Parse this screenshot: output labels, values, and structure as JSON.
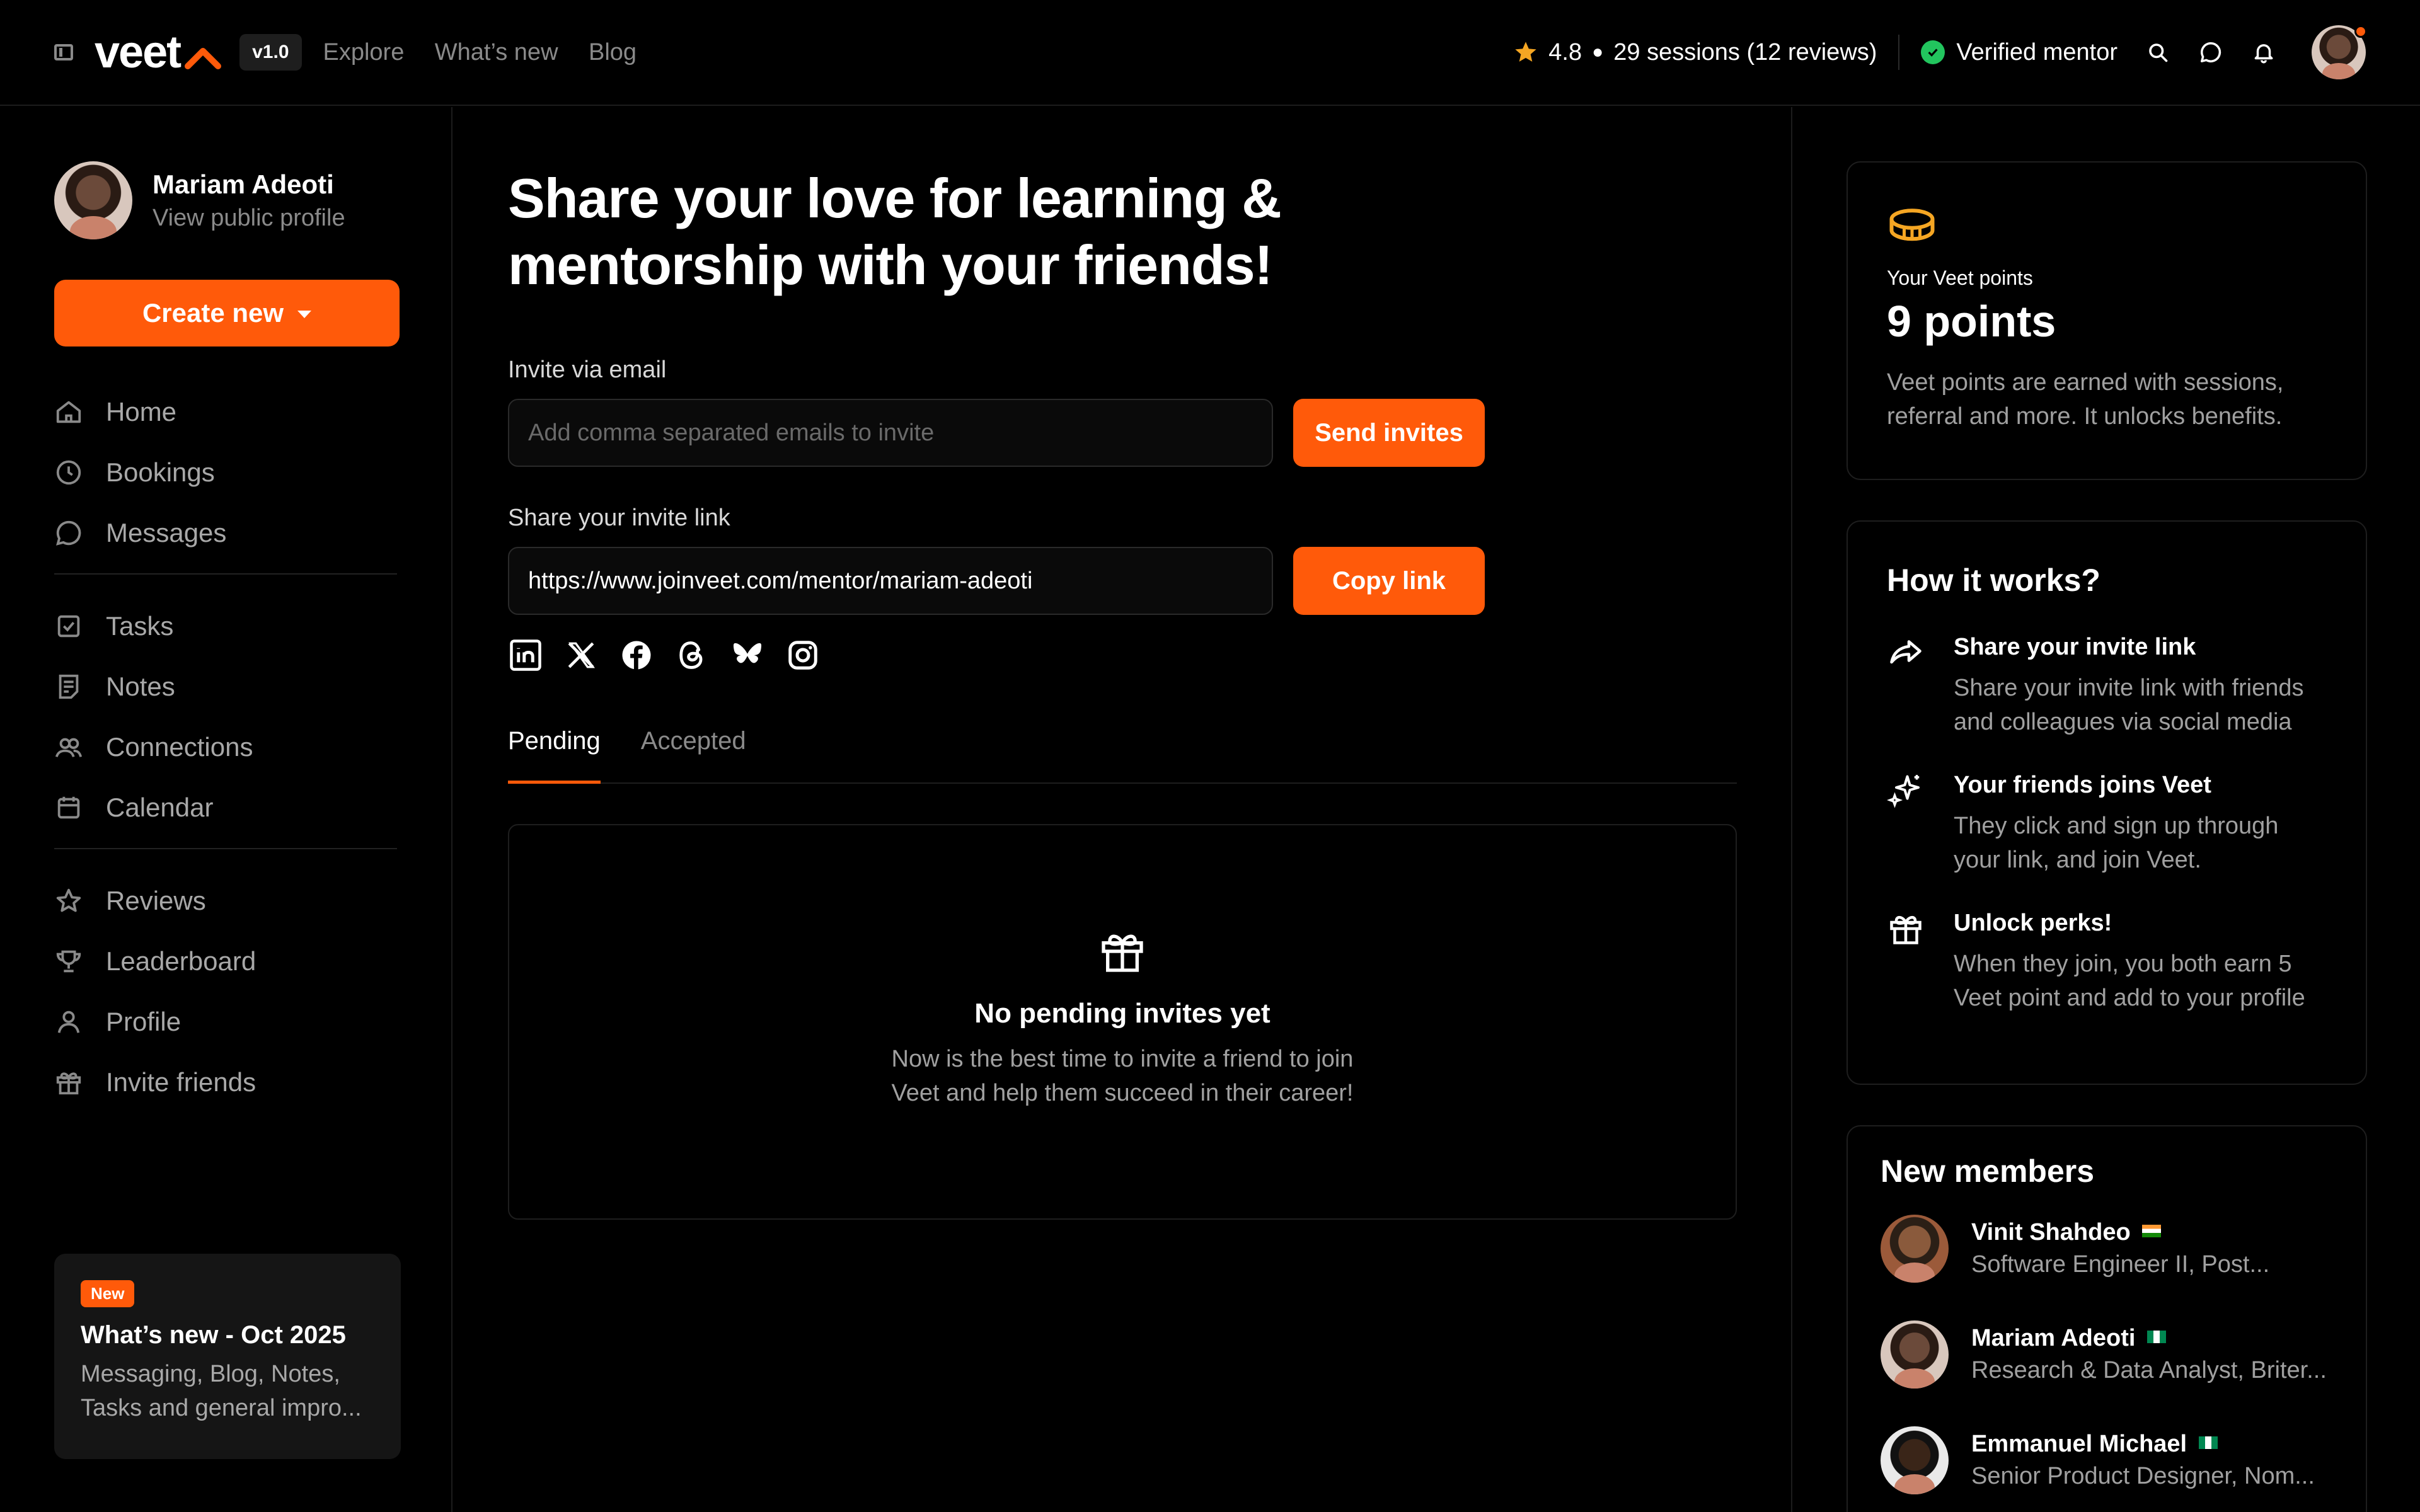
{
  "topbar": {
    "logo_text": "veet",
    "version": "v1.0",
    "nav": [
      "Explore",
      "What’s new",
      "Blog"
    ],
    "rating": "4.8",
    "sessions": "29 sessions (12 reviews)",
    "verified": "Verified mentor"
  },
  "sidebar": {
    "profile_name": "Mariam Adeoti",
    "profile_link": "View public profile",
    "create_label": "Create new",
    "groups": [
      [
        {
          "label": "Home",
          "icon": "home-icon"
        },
        {
          "label": "Bookings",
          "icon": "clock-icon"
        },
        {
          "label": "Messages",
          "icon": "message-icon"
        }
      ],
      [
        {
          "label": "Tasks",
          "icon": "checkbox-icon"
        },
        {
          "label": "Notes",
          "icon": "note-icon"
        },
        {
          "label": "Connections",
          "icon": "users-icon"
        },
        {
          "label": "Calendar",
          "icon": "calendar-icon"
        }
      ],
      [
        {
          "label": "Reviews",
          "icon": "star-icon"
        },
        {
          "label": "Leaderboard",
          "icon": "trophy-icon"
        },
        {
          "label": "Profile",
          "icon": "user-icon"
        },
        {
          "label": "Invite friends",
          "icon": "gift-icon"
        }
      ]
    ],
    "whatsnew": {
      "badge": "New",
      "title": "What’s new - Oct 2025",
      "body": "Messaging, Blog, Notes, Tasks and general impro..."
    }
  },
  "main": {
    "headline_1": "Share your love for learning &",
    "headline_2": "mentorship with your friends!",
    "email_label": "Invite via email",
    "email_placeholder": "Add comma separated emails to invite",
    "send_label": "Send invites",
    "link_label": "Share your invite link",
    "link_value": "https://www.joinveet.com/mentor/mariam-adeoti",
    "copy_label": "Copy link",
    "socials": [
      "linkedin-icon",
      "x-icon",
      "facebook-icon",
      "threads-icon",
      "bluesky-icon",
      "instagram-icon"
    ],
    "tabs": [
      "Pending",
      "Accepted"
    ],
    "active_tab": "Pending",
    "empty_title": "No pending invites yet",
    "empty_line_1": "Now is the best time to invite a friend to join",
    "empty_line_2": "Veet and help them succeed in their career!"
  },
  "right": {
    "points_label": "Your Veet points",
    "points_value": "9 points",
    "points_desc_1": "Veet  points are earned with sessions,",
    "points_desc_2": "referral and more. It unlocks benefits.",
    "how_title": "How it works?",
    "steps": [
      {
        "title": "Share your invite link",
        "desc_1": "Share your invite link with friends",
        "desc_2": "and colleagues via social media",
        "icon": "share-icon"
      },
      {
        "title": "Your friends joins Veet",
        "desc_1": "They click and sign up through",
        "desc_2": "your link, and join Veet.",
        "icon": "sparkle-icon"
      },
      {
        "title": "Unlock perks!",
        "desc_1": "When they join, you both earn 5",
        "desc_2": "Veet point and add to your profile",
        "icon": "gift-icon"
      }
    ],
    "members_title": "New members",
    "members": [
      {
        "name": "Vinit Shahdeo",
        "role": "Software Engineer II, Post...",
        "flag": "in"
      },
      {
        "name": "Mariam Adeoti",
        "role": "Research & Data Analyst, Briter...",
        "flag": "ng"
      },
      {
        "name": "Emmanuel Michael",
        "role": "Senior Product Designer, Nom...",
        "flag": "ng"
      }
    ]
  },
  "colors": {
    "accent": "#ff5a0a",
    "background": "#000000",
    "muted_text": "#a0a0a0",
    "verified": "#22c55e",
    "star": "#f5a623"
  }
}
